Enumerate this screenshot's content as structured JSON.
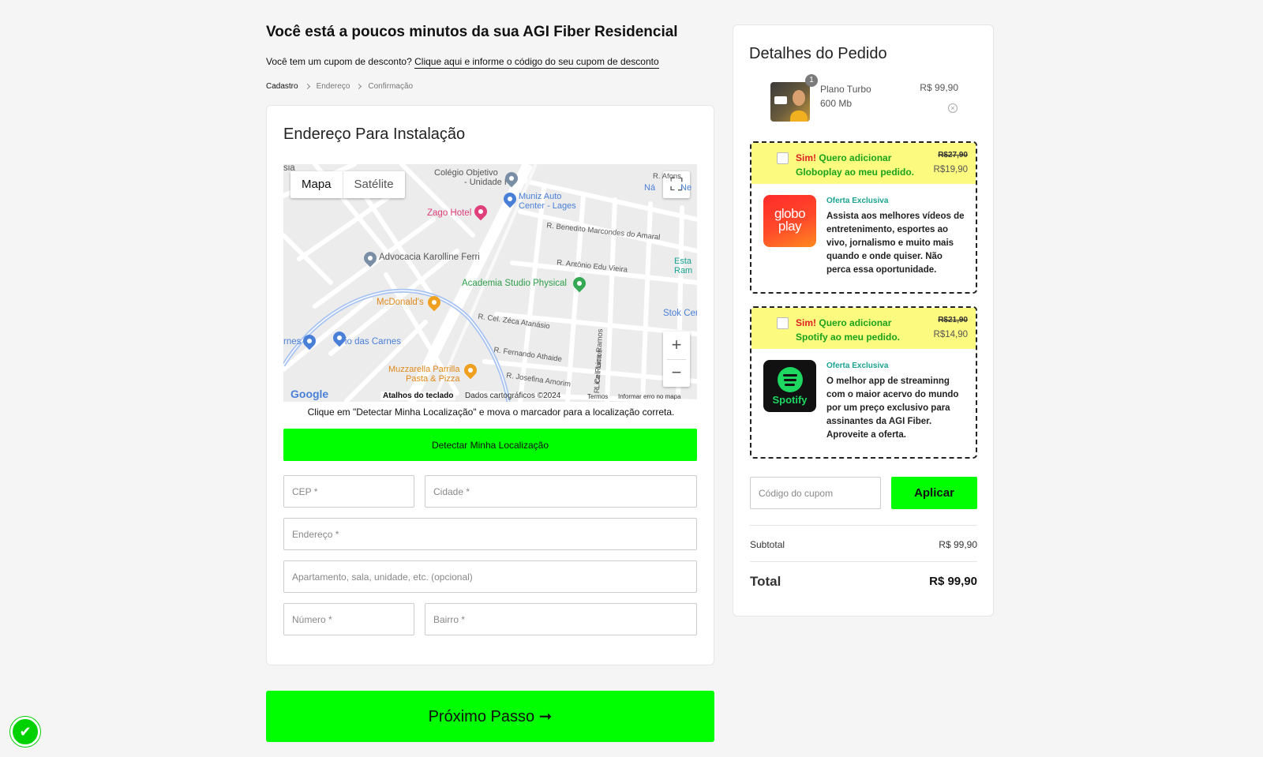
{
  "header": {
    "title": "Você está a poucos minutos da sua AGI Fiber Residencial",
    "coupon_question": "Você tem um cupom de desconto?",
    "coupon_link": "Clique aqui e informe o código do seu cupom de desconto"
  },
  "breadcrumb": [
    "Cadastro",
    "Endereço",
    "Confirmação"
  ],
  "address_form": {
    "title": "Endereço Para Instalação",
    "map": {
      "tab_map": "Mapa",
      "tab_satellite": "Satélite",
      "places": {
        "colegio": "Colégio Objetivo - Unidade I",
        "colegio_line1": "Colégio Objetivo",
        "colegio_line2": "- Unidade I",
        "muniz_line1": "Muniz Auto",
        "muniz_line2": "Center - Lages",
        "zago": "Zago Hotel",
        "advocacia": "Advocacia Karolline Ferri",
        "academia": "Academia Studio Physical",
        "mcdonalds": "McDonald's",
        "carnes": "io das Carnes",
        "carnes_left": "rnes",
        "muzzarella_line1": "Muzzarella Parrilla",
        "muzzarella_line2": "Pasta & Pizza",
        "stok": "Stok Cen",
        "esta_line1": "Esta",
        "esta_line2": "Ram",
        "afons_line1": "R. Afons",
        "afons_line2": "Ná",
        "afons_line2b": "Ne",
        "sia": "sia"
      },
      "streets": {
        "benedito": "R. Benedito Marcondes do Amaral",
        "antonio": "R. Antônio Edu Vieira",
        "zeca": "R. Cel. Zéca Atanásio",
        "fernando": "R. Fernando Athaide",
        "josefina": "R. Josefina Amorim",
        "lica1": "R. Cel. Lica Ramos",
        "lica2": "Lica Ramos"
      },
      "google_logo": "Google",
      "keyboard_shortcuts": "Atalhos do teclado",
      "map_data": "Dados cartográficos ©2024",
      "terms": "Termos",
      "report_error": "Informar erro no mapa"
    },
    "hint": "Clique em \"Detectar Minha Localização\" e mova o marcador para a localização correta.",
    "detect_button": "Detectar Minha Localização",
    "fields": {
      "cep": "CEP *",
      "cidade": "Cidade *",
      "endereco": "Endereço *",
      "apartamento": "Apartamento, sala, unidade, etc. (opcional)",
      "numero": "Número *",
      "bairro": "Bairro *"
    }
  },
  "next_button": "Próximo Passo ➞",
  "order": {
    "title": "Detalhes do Pedido",
    "product": {
      "name_line1": "Plano Turbo",
      "name_line2": "600 Mb",
      "price": "R$ 99,90",
      "quantity": "1"
    },
    "offers": [
      {
        "sim": "Sim!",
        "line1": "Quero adicionar",
        "line2": "Globoplay ao meu pedido.",
        "old_price": "R$27,90",
        "new_price": "R$19,90",
        "exclusive": "Oferta Exclusiva",
        "description": "Assista aos melhores vídeos de entretenimento, esportes ao vivo, jornalismo e muito mais quando e onde quiser. Não perca essa oportunidade.",
        "logo_line1": "globo",
        "logo_line2": "play"
      },
      {
        "sim": "Sim!",
        "line1": "Quero adicionar",
        "line2": "Spotify ao meu pedido.",
        "old_price": "R$21,90",
        "new_price": "R$14,90",
        "exclusive": "Oferta Exclusiva",
        "description": "O melhor app de streaminng com o maior acervo do mundo por um preço exclusivo para assinantes da AGI Fiber. Aproveite a oferta.",
        "logo_label": "Spotify"
      }
    ],
    "coupon_placeholder": "Código do cupom",
    "apply_button": "Aplicar",
    "subtotal_label": "Subtotal",
    "subtotal_value": "R$ 99,90",
    "total_label": "Total",
    "total_value": "R$ 99,90"
  },
  "colors": {
    "accent_green": "#00ff00",
    "offer_yellow": "#fdfa80",
    "offer_green_text": "#1aa31a",
    "offer_red_text": "#e02020"
  }
}
